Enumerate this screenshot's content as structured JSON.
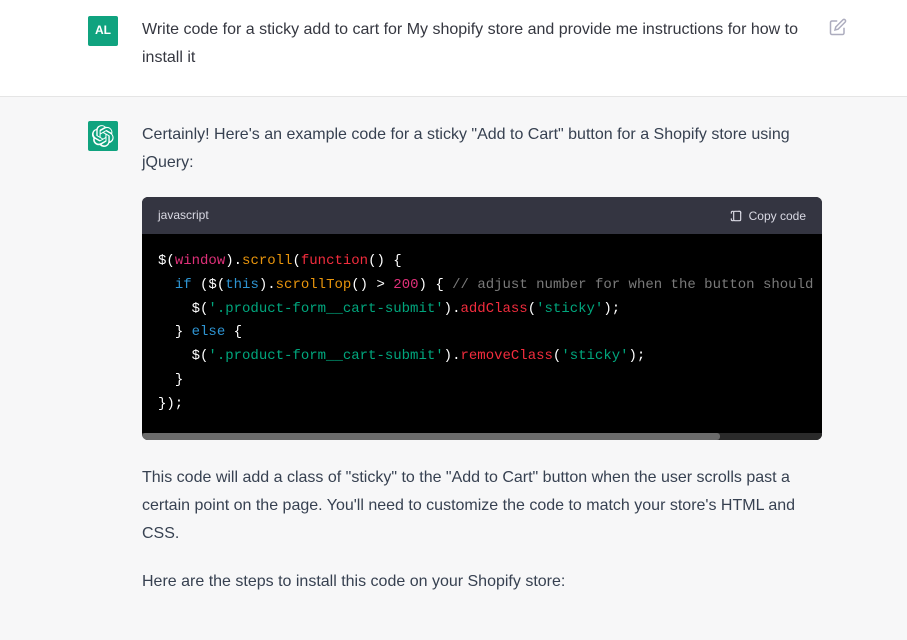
{
  "user": {
    "avatar_text": "AL",
    "message": "Write code for a sticky add to cart for My shopify store and provide me instructions for how to install it"
  },
  "assistant": {
    "intro": "Certainly! Here's an example code for a sticky \"Add to Cart\" button for a Shopify store using jQuery:",
    "code": {
      "language": "javascript",
      "copy_label": "Copy code",
      "lines": [
        {
          "tokens": [
            {
              "t": "$(",
              "c": "paren"
            },
            {
              "t": "window",
              "c": "global"
            },
            {
              "t": ").",
              "c": "paren"
            },
            {
              "t": "scroll",
              "c": "method"
            },
            {
              "t": "(",
              "c": "paren"
            },
            {
              "t": "function",
              "c": "function"
            },
            {
              "t": "() {",
              "c": "paren"
            }
          ]
        },
        {
          "indent": 1,
          "tokens": [
            {
              "t": "if",
              "c": "keyword"
            },
            {
              "t": " ($(",
              "c": "paren"
            },
            {
              "t": "this",
              "c": "keyword"
            },
            {
              "t": ").",
              "c": "paren"
            },
            {
              "t": "scrollTop",
              "c": "method"
            },
            {
              "t": "() > ",
              "c": "paren"
            },
            {
              "t": "200",
              "c": "number"
            },
            {
              "t": ") { ",
              "c": "paren"
            },
            {
              "t": "// adjust number for when the button should beco",
              "c": "comment"
            }
          ]
        },
        {
          "indent": 2,
          "tokens": [
            {
              "t": "$(",
              "c": "paren"
            },
            {
              "t": "'.product-form__cart-submit'",
              "c": "string"
            },
            {
              "t": ").",
              "c": "paren"
            },
            {
              "t": "addClass",
              "c": "function"
            },
            {
              "t": "(",
              "c": "paren"
            },
            {
              "t": "'sticky'",
              "c": "string"
            },
            {
              "t": ");",
              "c": "paren"
            }
          ]
        },
        {
          "indent": 1,
          "tokens": [
            {
              "t": "} ",
              "c": "paren"
            },
            {
              "t": "else",
              "c": "keyword"
            },
            {
              "t": " {",
              "c": "paren"
            }
          ]
        },
        {
          "indent": 2,
          "tokens": [
            {
              "t": "$(",
              "c": "paren"
            },
            {
              "t": "'.product-form__cart-submit'",
              "c": "string"
            },
            {
              "t": ").",
              "c": "paren"
            },
            {
              "t": "removeClass",
              "c": "function"
            },
            {
              "t": "(",
              "c": "paren"
            },
            {
              "t": "'sticky'",
              "c": "string"
            },
            {
              "t": ");",
              "c": "paren"
            }
          ]
        },
        {
          "indent": 1,
          "tokens": [
            {
              "t": "}",
              "c": "paren"
            }
          ]
        },
        {
          "tokens": [
            {
              "t": "});",
              "c": "paren"
            }
          ]
        }
      ]
    },
    "explanation": "This code will add a class of \"sticky\" to the \"Add to Cart\" button when the user scrolls past a certain point on the page. You'll need to customize the code to match your store's HTML and CSS.",
    "steps_intro": "Here are the steps to install this code on your Shopify store:"
  }
}
